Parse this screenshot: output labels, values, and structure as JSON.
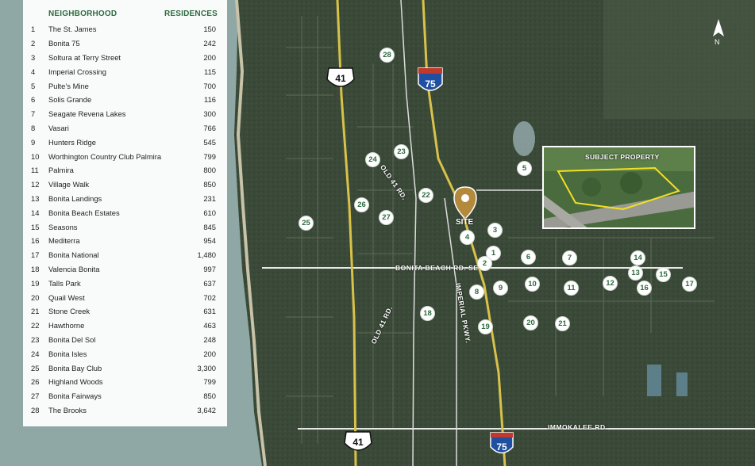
{
  "legend": {
    "header_name": "NEIGHBORHOOD",
    "header_res": "RESIDENCES",
    "rows": [
      {
        "num": "1",
        "name": "The St. James",
        "res": "150"
      },
      {
        "num": "2",
        "name": "Bonita 75",
        "res": "242"
      },
      {
        "num": "3",
        "name": "Soltura at Terry Street",
        "res": "200"
      },
      {
        "num": "4",
        "name": "Imperial Crossing",
        "res": "115"
      },
      {
        "num": "5",
        "name": "Pulte’s Mine",
        "res": "700"
      },
      {
        "num": "6",
        "name": "Solis Grande",
        "res": "116"
      },
      {
        "num": "7",
        "name": "Seagate Revena Lakes",
        "res": "300"
      },
      {
        "num": "8",
        "name": "Vasari",
        "res": "766"
      },
      {
        "num": "9",
        "name": "Hunters Ridge",
        "res": "545"
      },
      {
        "num": "10",
        "name": "Worthington Country Club Palmira",
        "res": "799"
      },
      {
        "num": "11",
        "name": "Palmira",
        "res": "800"
      },
      {
        "num": "12",
        "name": "Village Walk",
        "res": "850"
      },
      {
        "num": "13",
        "name": "Bonita Landings",
        "res": "231"
      },
      {
        "num": "14",
        "name": "Bonita Beach Estates",
        "res": "610"
      },
      {
        "num": "15",
        "name": "Seasons",
        "res": "845"
      },
      {
        "num": "16",
        "name": "Mediterra",
        "res": "954"
      },
      {
        "num": "17",
        "name": "Bonita National",
        "res": "1,480"
      },
      {
        "num": "18",
        "name": "Valencia Bonita",
        "res": "997"
      },
      {
        "num": "19",
        "name": "Talls Park",
        "res": "637"
      },
      {
        "num": "20",
        "name": "Quail West",
        "res": "702"
      },
      {
        "num": "21",
        "name": "Stone Creek",
        "res": "631"
      },
      {
        "num": "22",
        "name": "Hawthorne",
        "res": "463"
      },
      {
        "num": "23",
        "name": "Bonita Del Sol",
        "res": "248"
      },
      {
        "num": "24",
        "name": "Bonita Isles",
        "res": "200"
      },
      {
        "num": "25",
        "name": "Bonita Bay Club",
        "res": "3,300"
      },
      {
        "num": "26",
        "name": "Highland Woods",
        "res": "799"
      },
      {
        "num": "27",
        "name": "Bonita Fairways",
        "res": "850"
      },
      {
        "num": "28",
        "name": "The Brooks",
        "res": "3,642"
      }
    ]
  },
  "markers": [
    "1",
    "2",
    "3",
    "4",
    "5",
    "6",
    "7",
    "8",
    "9",
    "10",
    "11",
    "12",
    "13",
    "14",
    "15",
    "16",
    "17",
    "18",
    "19",
    "20",
    "21",
    "22",
    "23",
    "24",
    "25",
    "26",
    "27",
    "28"
  ],
  "site_label": "SITE",
  "inset_label": "SUBJECT PROPERTY",
  "roads": {
    "bonita_beach": "BONITA BEACH RD. SE",
    "immokalee": "IMMOKALEE RD.",
    "old41_north": "OLD 41 RD.",
    "old41_south": "OLD 41 RD.",
    "imperial": "IMPERIAL PKWY."
  },
  "shields": {
    "us41_top": "41",
    "us41_bottom": "41",
    "i75_top": "75",
    "i75_bottom": "75",
    "interstate": "INTERSTATE"
  },
  "compass": "N",
  "colors": {
    "accent": "#2e6b3f",
    "highway": "#d8c24a",
    "road": "#e8e8e8",
    "land": "#3a4a37",
    "water": "#8aa7a8"
  }
}
